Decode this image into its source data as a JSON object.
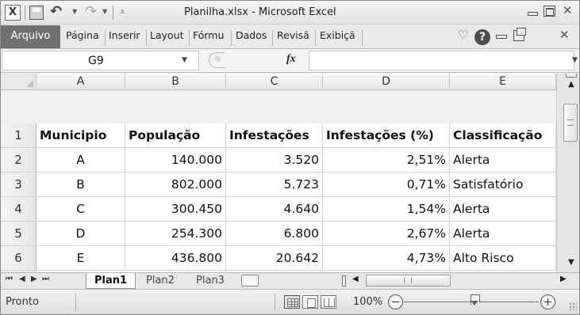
{
  "window": {
    "title": "Planilha.xlsx - Microsoft Excel",
    "app_icon": "X",
    "icons": [
      "excel-app-icon",
      "save-icon",
      "undo-icon",
      "redo-icon",
      "minimize-icon",
      "restore-icon",
      "close-icon"
    ]
  },
  "ribbon": {
    "file_tab": "Arquivo",
    "tabs": [
      "Página",
      "Inserir",
      "Layout",
      "Fórmu",
      "Dados",
      "Revisã",
      "Exibiçã"
    ],
    "help_label": "?"
  },
  "formula_bar": {
    "name_box": "G9",
    "fx_label": "fx",
    "formula": ""
  },
  "columns": [
    "A",
    "B",
    "C",
    "D",
    "E"
  ],
  "rows": [
    "1",
    "2",
    "3",
    "4",
    "5",
    "6"
  ],
  "table": {
    "header": [
      "Municipio",
      "População",
      "Infestações",
      "Infestações (%)",
      "Classificação"
    ],
    "data": [
      [
        "A",
        "140.000",
        "3.520",
        "2,51%",
        "Alerta"
      ],
      [
        "B",
        "802.000",
        "5.723",
        "0,71%",
        "Satisfatório"
      ],
      [
        "C",
        "300.450",
        "4.640",
        "1,54%",
        "Alerta"
      ],
      [
        "D",
        "254.300",
        "6.800",
        "2,67%",
        "Alerta"
      ],
      [
        "E",
        "436.800",
        "20.642",
        "4,73%",
        "Alto Risco"
      ]
    ]
  },
  "sheets": {
    "tabs": [
      "Plan1",
      "Plan2",
      "Plan3"
    ],
    "active": "Plan1"
  },
  "status": {
    "text": "Pronto",
    "zoom": "100%",
    "zoom_value": 100
  },
  "colors": {
    "file_tab": "#707070",
    "grid_line": "#d4d4d4",
    "header_bg": "#e6e6e6"
  }
}
